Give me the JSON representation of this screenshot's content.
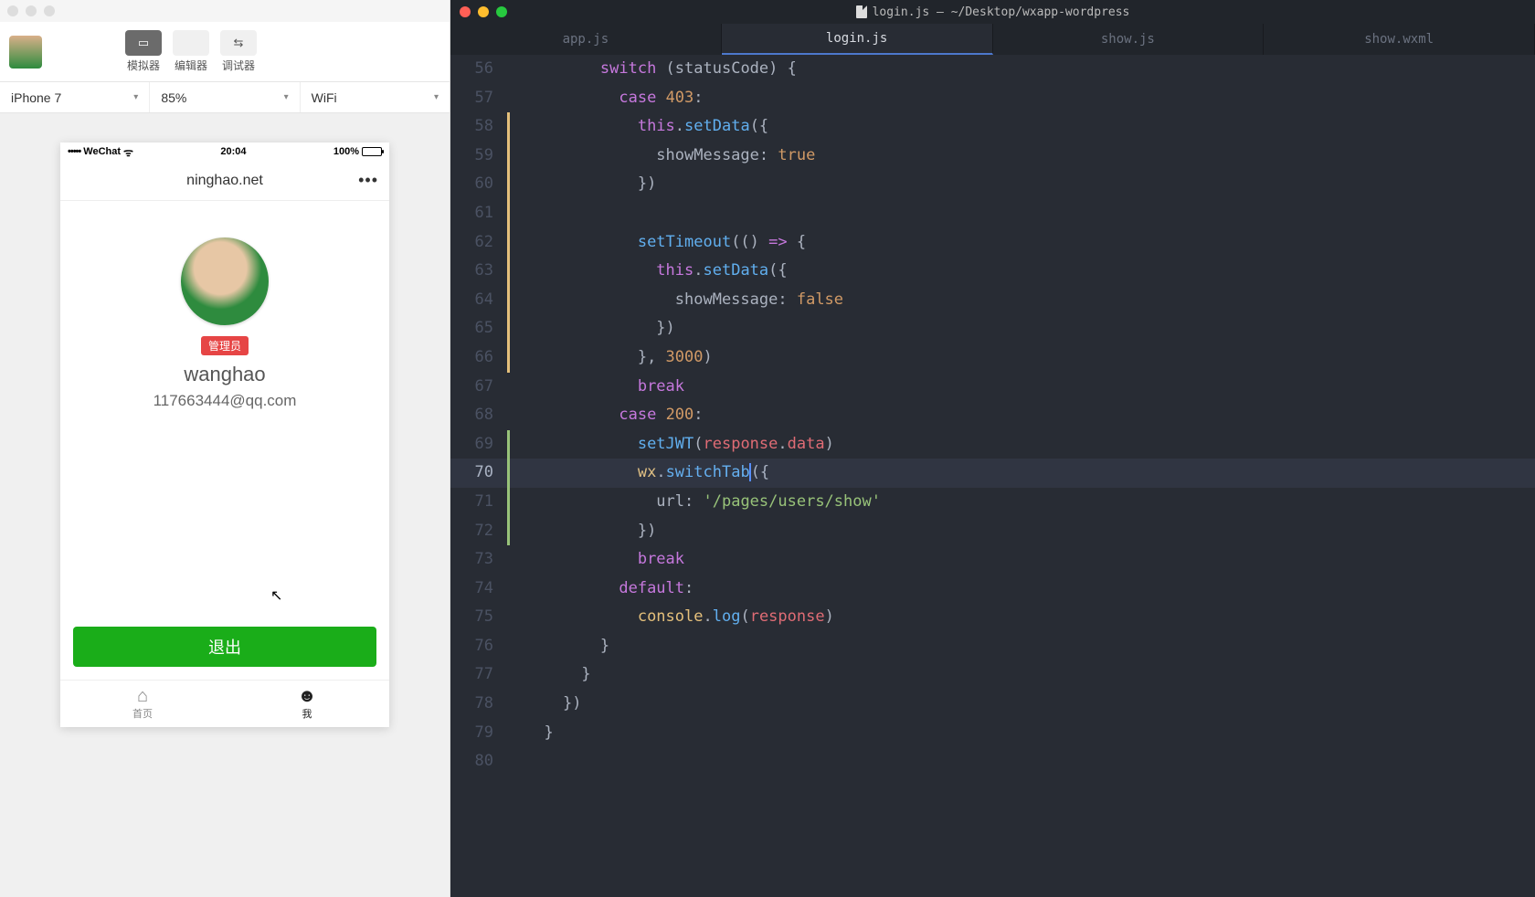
{
  "editor": {
    "window_title": "login.js — ~/Desktop/wxapp-wordpress",
    "tabs": [
      {
        "label": "app.js",
        "active": false
      },
      {
        "label": "login.js",
        "active": true
      },
      {
        "label": "show.js",
        "active": false
      },
      {
        "label": "show.wxml",
        "active": false
      }
    ],
    "line_start": 56,
    "line_end": 80,
    "active_line": 71,
    "code_lines": [
      {
        "n": 56,
        "ind": 4,
        "git": "",
        "tokens": [
          [
            "kw",
            "switch"
          ],
          [
            "pn",
            " ("
          ],
          [
            "id",
            "statusCode"
          ],
          [
            "pn",
            ") {"
          ]
        ]
      },
      {
        "n": 57,
        "ind": 5,
        "git": "",
        "tokens": [
          [
            "kw",
            "case"
          ],
          [
            "pn",
            " "
          ],
          [
            "num",
            "403"
          ],
          [
            "pn",
            ":"
          ]
        ]
      },
      {
        "n": 58,
        "ind": 6,
        "git": "mod",
        "tokens": [
          [
            "kw",
            "this"
          ],
          [
            "pn",
            "."
          ],
          [
            "fn",
            "setData"
          ],
          [
            "pn",
            "({"
          ]
        ]
      },
      {
        "n": 59,
        "ind": 7,
        "git": "mod",
        "tokens": [
          [
            "id",
            "showMessage"
          ],
          [
            "pn",
            ": "
          ],
          [
            "bool",
            "true"
          ]
        ]
      },
      {
        "n": 60,
        "ind": 6,
        "git": "mod",
        "tokens": [
          [
            "pn",
            "})"
          ]
        ]
      },
      {
        "n": 61,
        "ind": 0,
        "git": "mod",
        "tokens": []
      },
      {
        "n": 62,
        "ind": 6,
        "git": "mod",
        "tokens": [
          [
            "fn",
            "setTimeout"
          ],
          [
            "pn",
            "(() "
          ],
          [
            "kw",
            "=>"
          ],
          [
            "pn",
            " {"
          ]
        ]
      },
      {
        "n": 63,
        "ind": 7,
        "git": "mod",
        "tokens": [
          [
            "kw",
            "this"
          ],
          [
            "pn",
            "."
          ],
          [
            "fn",
            "setData"
          ],
          [
            "pn",
            "({"
          ]
        ]
      },
      {
        "n": 64,
        "ind": 8,
        "git": "mod",
        "tokens": [
          [
            "id",
            "showMessage"
          ],
          [
            "pn",
            ": "
          ],
          [
            "bool",
            "false"
          ]
        ]
      },
      {
        "n": 65,
        "ind": 7,
        "git": "mod",
        "tokens": [
          [
            "pn",
            "})"
          ]
        ]
      },
      {
        "n": 66,
        "ind": 6,
        "git": "mod",
        "tokens": [
          [
            "pn",
            "}, "
          ],
          [
            "num",
            "3000"
          ],
          [
            "pn",
            ")"
          ]
        ]
      },
      {
        "n": 67,
        "ind": 6,
        "git": "",
        "tokens": [
          [
            "kw",
            "break"
          ]
        ]
      },
      {
        "n": 68,
        "ind": 5,
        "git": "",
        "tokens": [
          [
            "kw",
            "case"
          ],
          [
            "pn",
            " "
          ],
          [
            "num",
            "200"
          ],
          [
            "pn",
            ":"
          ]
        ]
      },
      {
        "n": 69,
        "ind": 6,
        "git": "new",
        "tokens": [
          [
            "fn",
            "setJWT"
          ],
          [
            "pn",
            "("
          ],
          [
            "prop",
            "response"
          ],
          [
            "pn",
            "."
          ],
          [
            "prop",
            "data"
          ],
          [
            "pn",
            ")"
          ]
        ]
      },
      {
        "n": 70,
        "ind": 6,
        "git": "new",
        "active": true,
        "tokens": [
          [
            "obj",
            "wx"
          ],
          [
            "pn",
            "."
          ],
          [
            "fn",
            "switchTab"
          ],
          [
            "caret",
            ""
          ],
          [
            "pn",
            "({"
          ]
        ]
      },
      {
        "n": 71,
        "ind": 7,
        "git": "new",
        "tokens": [
          [
            "id",
            "url"
          ],
          [
            "pn",
            ": "
          ],
          [
            "str",
            "'/pages/users/show'"
          ]
        ]
      },
      {
        "n": 72,
        "ind": 6,
        "git": "new",
        "tokens": [
          [
            "pn",
            "})"
          ]
        ]
      },
      {
        "n": 73,
        "ind": 6,
        "git": "",
        "tokens": [
          [
            "kw",
            "break"
          ]
        ]
      },
      {
        "n": 74,
        "ind": 5,
        "git": "",
        "tokens": [
          [
            "kw",
            "default"
          ],
          [
            "pn",
            ":"
          ]
        ]
      },
      {
        "n": 75,
        "ind": 6,
        "git": "",
        "tokens": [
          [
            "obj",
            "console"
          ],
          [
            "pn",
            "."
          ],
          [
            "fn",
            "log"
          ],
          [
            "pn",
            "("
          ],
          [
            "prop",
            "response"
          ],
          [
            "pn",
            ")"
          ]
        ]
      },
      {
        "n": 76,
        "ind": 4,
        "git": "",
        "tokens": [
          [
            "pn",
            "}"
          ]
        ]
      },
      {
        "n": 77,
        "ind": 3,
        "git": "",
        "tokens": [
          [
            "pn",
            "}"
          ]
        ]
      },
      {
        "n": 78,
        "ind": 2,
        "git": "",
        "tokens": [
          [
            "pn",
            "})"
          ]
        ]
      },
      {
        "n": 79,
        "ind": 1,
        "git": "",
        "tokens": [
          [
            "pn",
            "}"
          ]
        ]
      },
      {
        "n": 80,
        "ind": 0,
        "git": "",
        "tokens": []
      }
    ]
  },
  "devtool": {
    "toolbar": [
      {
        "icon": "▭",
        "label": "模拟器",
        "active": true
      },
      {
        "icon": "</>",
        "label": "编辑器",
        "active": false
      },
      {
        "icon": "⇆",
        "label": "调试器",
        "active": false
      }
    ],
    "options": {
      "device": "iPhone 7",
      "zoom": "85%",
      "network": "WiFi"
    }
  },
  "phone": {
    "status": {
      "carrier": "WeChat",
      "time": "20:04",
      "battery": "100%"
    },
    "nav_title": "ninghao.net",
    "role_badge": "管理员",
    "username": "wanghao",
    "email": "117663444@qq.com",
    "logout": "退出",
    "tabs": [
      {
        "icon": "⌂",
        "label": "首页",
        "active": false
      },
      {
        "icon": "☻",
        "label": "我",
        "active": true
      }
    ]
  }
}
